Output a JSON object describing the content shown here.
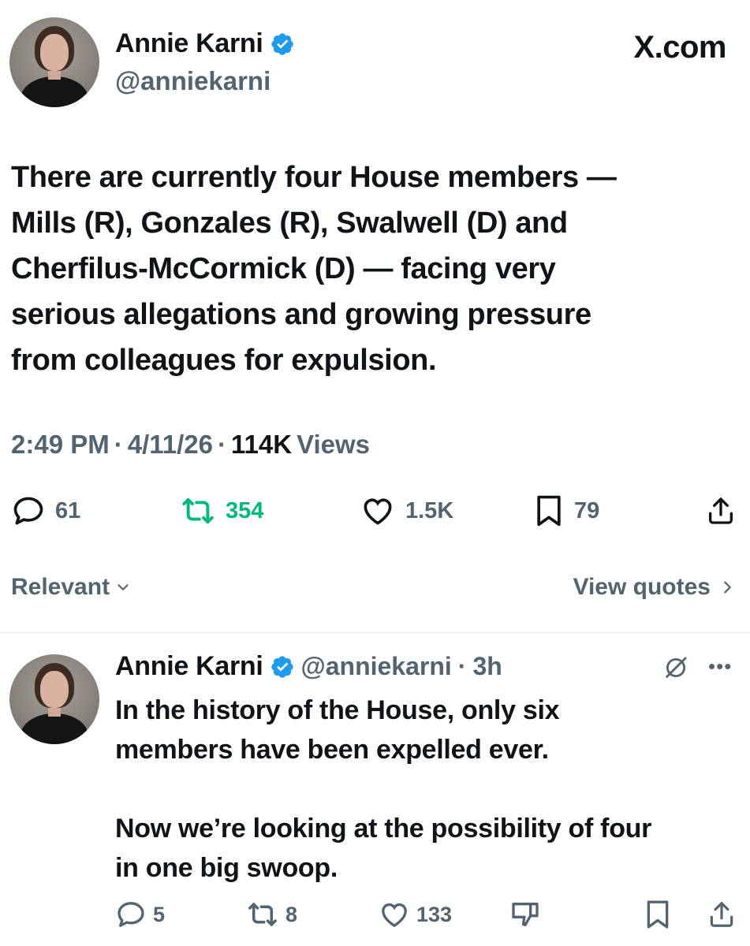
{
  "main_tweet": {
    "author": {
      "display_name": "Annie Karni",
      "handle": "@anniekarni",
      "verified": true
    },
    "brand": "X.com",
    "text": "There are currently four House members —\nMills (R), Gonzales (R), Swalwell (D) and\nCherfilus-McCormick (D) — facing very\nserious allegations and growing pressure\nfrom colleagues for expulsion.",
    "meta": {
      "time": "2:49 PM",
      "date": "4/11/26",
      "views_count": "114K",
      "views_label": "Views"
    },
    "actions": {
      "replies": "61",
      "reposts": "354",
      "likes": "1.5K",
      "bookmarks": "79"
    }
  },
  "sort": {
    "label": "Relevant",
    "view_quotes": "View quotes"
  },
  "reply_tweet": {
    "author": {
      "display_name": "Annie Karni",
      "handle": "@anniekarni",
      "age": "3h"
    },
    "text": "In the history of the House, only six\nmembers have been expelled ever.\n\nNow we’re looking at the possibility of four\nin one big swoop.",
    "actions": {
      "replies": "5",
      "reposts": "8",
      "likes": "133"
    }
  },
  "colors": {
    "text": "#0f1419",
    "secondary": "#536471",
    "verified": "#1d9bf0",
    "repost_active": "#00ba7c",
    "divider": "#e6eaec"
  },
  "icons": {
    "reply": "reply-icon",
    "repost": "repost-icon",
    "like": "heart-icon",
    "bookmark": "bookmark-icon",
    "share": "share-icon",
    "grok": "grok-icon",
    "more": "more-icon",
    "dislike": "thumbs-down-icon"
  }
}
